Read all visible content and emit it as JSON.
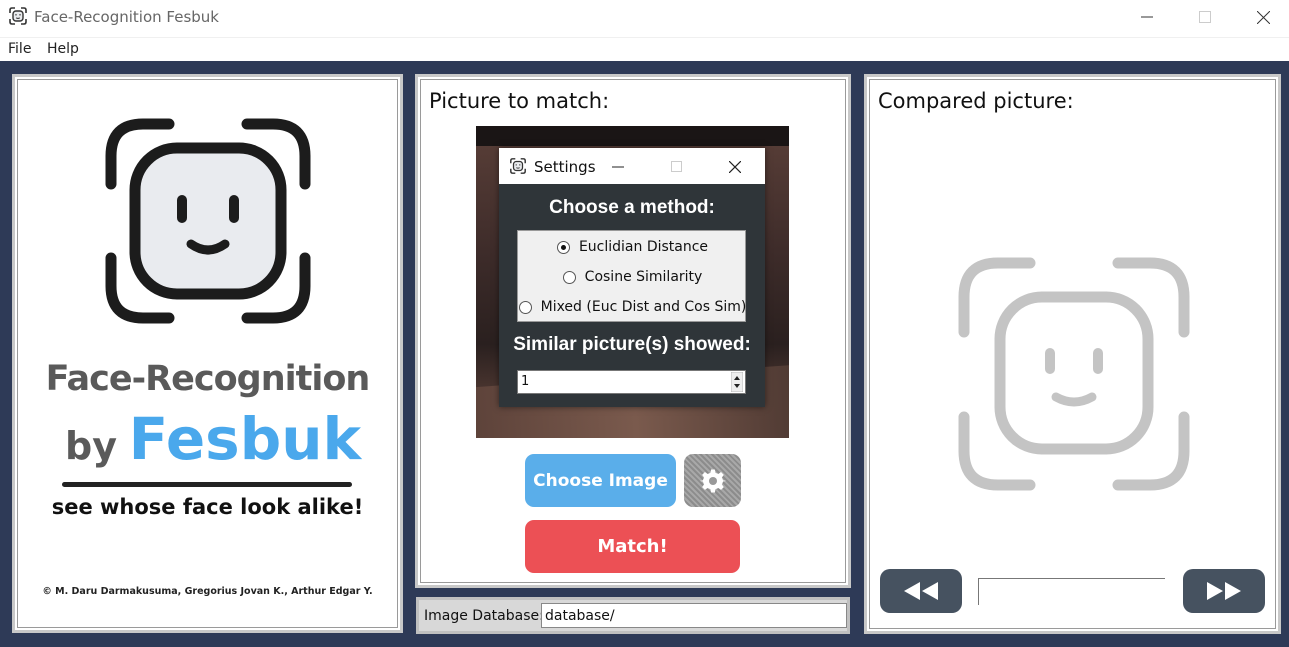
{
  "window": {
    "title": "Face-Recognition Fesbuk",
    "icon": "face-scan-icon",
    "controls": [
      "minimize-icon",
      "maximize-icon",
      "close-icon"
    ]
  },
  "menu": {
    "items": [
      "File",
      "Help"
    ]
  },
  "left_panel": {
    "logo_icon": "face-scan-icon",
    "line1": "Face-Recognition",
    "line2_by": "by",
    "line2_brand": "Fesbuk",
    "tagline": "see whose face look alike!",
    "credits": "© M. Daru Darmakusuma, Gregorius Jovan K., Arthur Edgar Y.",
    "colors": {
      "brand": "#4aa8ec",
      "text": "#5a5a5a"
    }
  },
  "middle_panel": {
    "heading": "Picture to match:",
    "choose_button": "Choose Image",
    "settings_icon": "gear-icon",
    "match_button": "Match!",
    "colors": {
      "choose": "#5aaeea",
      "match": "#ec5055"
    }
  },
  "settings_dialog": {
    "title": "Settings",
    "method_heading": "Choose a method:",
    "methods": [
      "Euclidian Distance",
      "Cosine Similarity",
      "Mixed (Euc Dist and Cos Sim)"
    ],
    "selected_method": "Euclidian Distance",
    "similar_heading": "Similar picture(s) showed:",
    "similar_value": "1"
  },
  "database": {
    "label": "Image Database:",
    "value": "database/"
  },
  "right_panel": {
    "heading": "Compared picture:",
    "placeholder_icon": "face-scan-icon",
    "prev_icon": "rewind-icon",
    "next_icon": "fast-forward-icon",
    "caption": ""
  }
}
